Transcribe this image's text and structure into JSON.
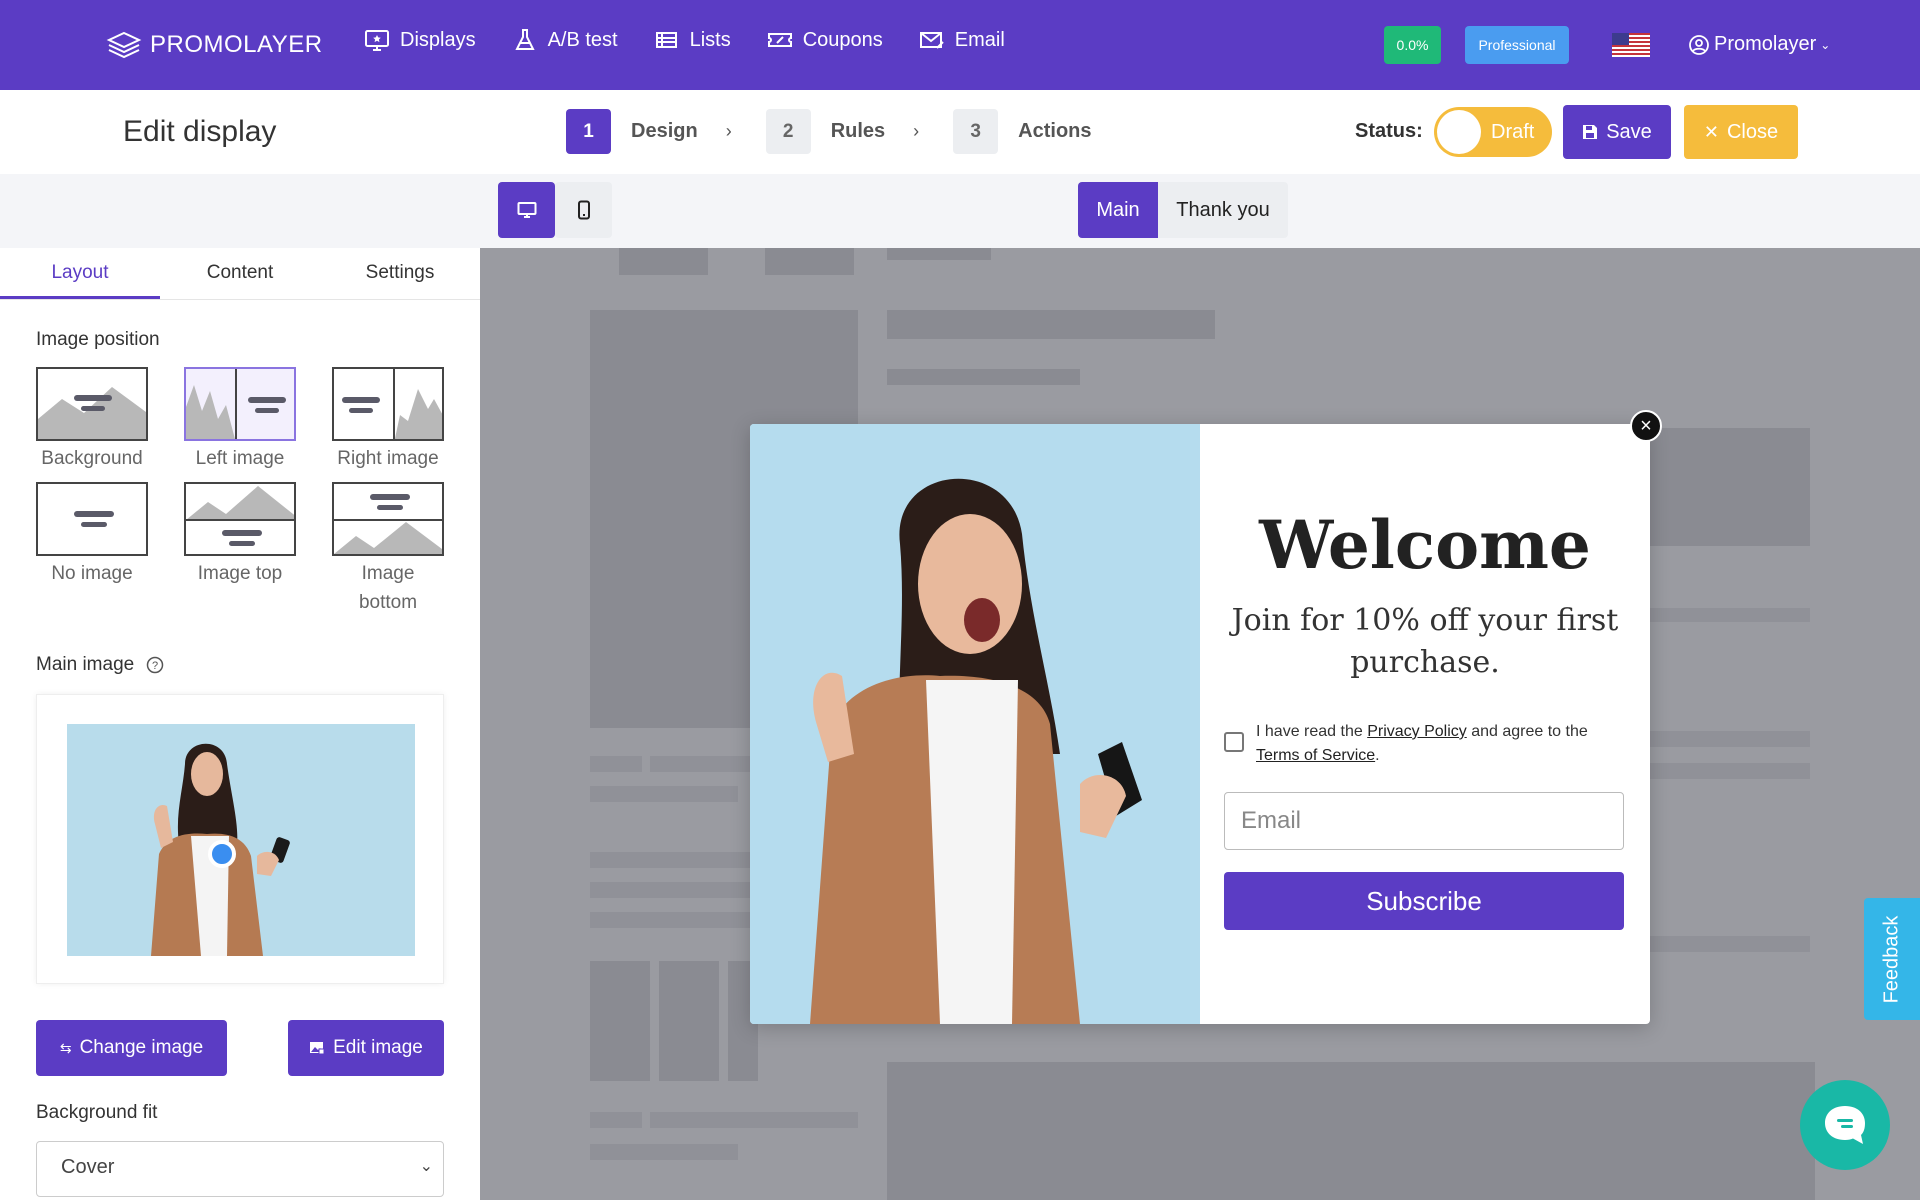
{
  "nav": {
    "brand": "PROMOLAYER",
    "items": [
      {
        "label": "Displays",
        "icon": "monitor-star-icon"
      },
      {
        "label": "A/B test",
        "icon": "flask-icon"
      },
      {
        "label": "Lists",
        "icon": "list-icon"
      },
      {
        "label": "Coupons",
        "icon": "ticket-icon"
      },
      {
        "label": "Email",
        "icon": "mail-edit-icon"
      }
    ],
    "conversion_badge": "0.0%",
    "plan_badge": "Professional",
    "user_menu": "Promolayer"
  },
  "header": {
    "title": "Edit display",
    "steps": [
      {
        "num": "1",
        "label": "Design"
      },
      {
        "num": "2",
        "label": "Rules"
      },
      {
        "num": "3",
        "label": "Actions"
      }
    ],
    "status_label": "Status:",
    "status_value": "Draft",
    "save_label": "Save",
    "close_label": "Close"
  },
  "sidebar": {
    "tabs": [
      "Layout",
      "Content",
      "Settings"
    ],
    "image_position_label": "Image position",
    "positions": [
      "Background",
      "Left image",
      "Right image",
      "No image",
      "Image top",
      "Image\nbottom"
    ],
    "main_image_label": "Main image",
    "change_image_label": "Change image",
    "edit_image_label": "Edit image",
    "bg_fit_label": "Background fit",
    "bg_fit_value": "Cover"
  },
  "canvas": {
    "screens": [
      "Main",
      "Thank you"
    ]
  },
  "popup": {
    "heading": "Welcome",
    "subtitle": "Join for 10% off your first purchase.",
    "consent_pre": "I have read the ",
    "privacy_link": "Privacy Policy",
    "consent_mid": " and agree to the ",
    "terms_link": "Terms of Service",
    "consent_post": ".",
    "email_placeholder": "Email",
    "subscribe_label": "Subscribe"
  },
  "feedback_label": "Feedback",
  "colors": {
    "brand": "#5b3cc4",
    "draft": "#f5bc3c",
    "success": "#1fb978",
    "info": "#4a9cf0",
    "feedback": "#34b6e8",
    "chat": "#19b8a6"
  }
}
